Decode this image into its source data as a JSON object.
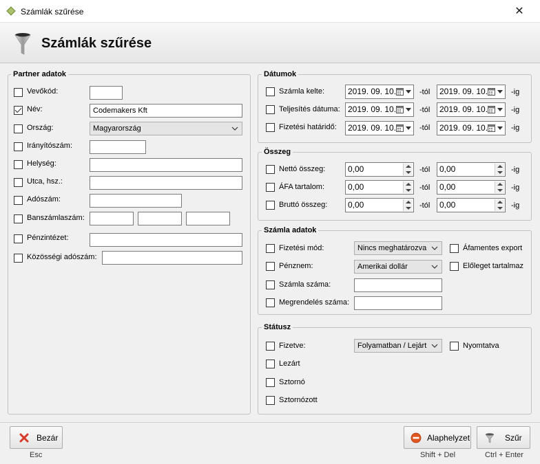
{
  "window": {
    "title": "Számlák szűrése",
    "close_glyph": "✕"
  },
  "header": {
    "title": "Számlák szűrése",
    "icon": "funnel-icon"
  },
  "partner": {
    "legend": "Partner adatok",
    "vevokod": {
      "label": "Vevőkód:",
      "checked": false,
      "value": ""
    },
    "nev": {
      "label": "Név:",
      "checked": true,
      "value": "Codemakers Kft"
    },
    "orszag": {
      "label": "Ország:",
      "checked": false,
      "value": "Magyarország"
    },
    "iranyitoszam": {
      "label": "Irányítószám:",
      "checked": false,
      "value": ""
    },
    "helyseg": {
      "label": "Helység:",
      "checked": false,
      "value": ""
    },
    "utca": {
      "label": "Utca, hsz.:",
      "checked": false,
      "value": ""
    },
    "adoszam": {
      "label": "Adószám:",
      "checked": false,
      "value": ""
    },
    "bankszamla": {
      "label": "Banszámlaszám:",
      "checked": false,
      "values": [
        "",
        "",
        ""
      ]
    },
    "penzintezet": {
      "label": "Pénzintézet:",
      "checked": false,
      "value": ""
    },
    "kozossegi": {
      "label": "Közösségi adószám:",
      "checked": false,
      "value": ""
    }
  },
  "datumok": {
    "legend": "Dátumok",
    "from_suffix": "-tól",
    "to_suffix": "-ig",
    "rows": [
      {
        "label": "Számla kelte:",
        "from": "2019. 09. 10.",
        "to": "2019. 09. 10."
      },
      {
        "label": "Teljesítés dátuma:",
        "from": "2019. 09. 10.",
        "to": "2019. 09. 10."
      },
      {
        "label": "Fizetési határidő:",
        "from": "2019. 09. 10.",
        "to": "2019. 09. 10."
      }
    ]
  },
  "osszeg": {
    "legend": "Összeg",
    "from_suffix": "-tól",
    "to_suffix": "-ig",
    "rows": [
      {
        "label": "Nettó összeg:",
        "from": "0,00",
        "to": "0,00"
      },
      {
        "label": "ÁFA tartalom:",
        "from": "0,00",
        "to": "0,00"
      },
      {
        "label": "Bruttó összeg:",
        "from": "0,00",
        "to": "0,00"
      }
    ]
  },
  "szamla": {
    "legend": "Számla adatok",
    "fizetesi_mod": {
      "label": "Fizetési mód:",
      "value": "Nincs meghatározva"
    },
    "penznem": {
      "label": "Pénznem:",
      "value": "Amerikai dollár"
    },
    "szamla_szama": {
      "label": "Számla száma:",
      "value": ""
    },
    "megrendeles": {
      "label": "Megrendelés száma:",
      "value": ""
    },
    "afamentes": {
      "label": "Áfamentes export"
    },
    "eloleg": {
      "label": "Előleget tartalmaz"
    }
  },
  "statusz": {
    "legend": "Státusz",
    "fizetve": {
      "label": "Fizetve:",
      "value": "Folyamatban / Lejárt"
    },
    "nyomtatva": {
      "label": "Nyomtatva"
    },
    "lezart": {
      "label": "Lezárt"
    },
    "sztorno": {
      "label": "Sztornó"
    },
    "sztornozott": {
      "label": "Sztornózott"
    }
  },
  "footer": {
    "close": {
      "label": "Bezár",
      "shortcut": "Esc",
      "icon": "close-x-icon",
      "color": "#d83a2a"
    },
    "reset": {
      "label": "Alaphelyzet",
      "shortcut": "Shift + Del",
      "icon": "no-entry-icon",
      "color": "#e2561f"
    },
    "filter": {
      "label": "Szűr",
      "shortcut": "Ctrl + Enter",
      "icon": "funnel-icon"
    }
  }
}
